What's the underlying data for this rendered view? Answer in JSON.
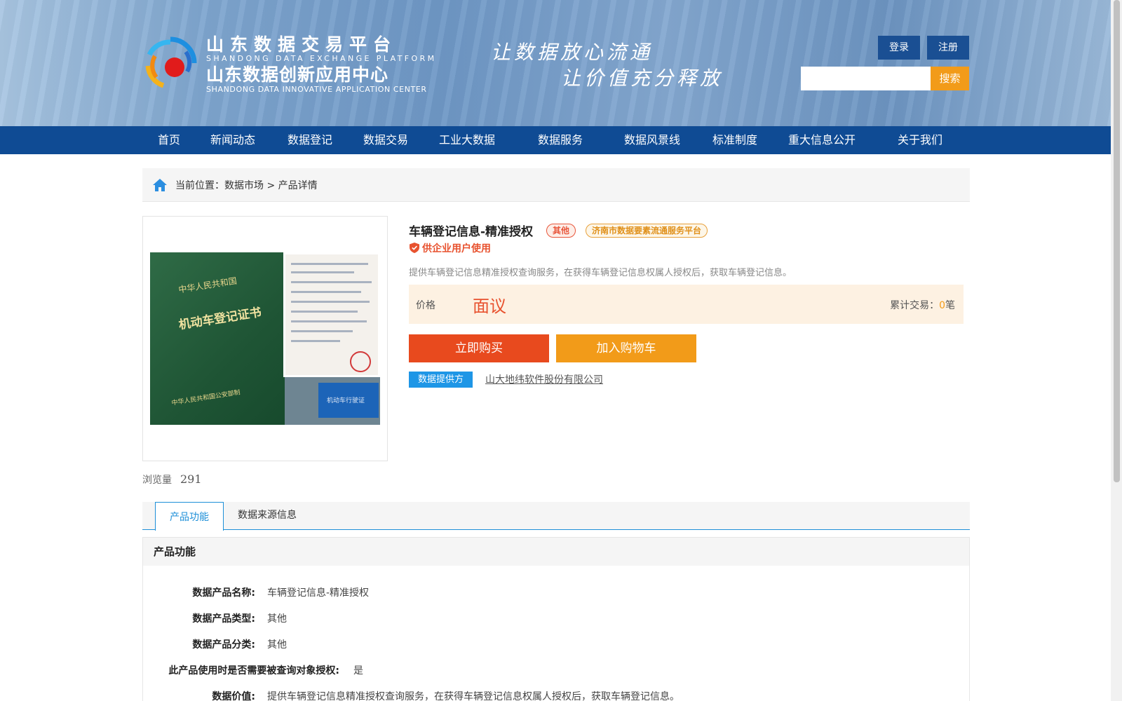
{
  "header": {
    "brand_cn1": "山东数据交易平台",
    "brand_en1": "SHANDONG DATA EXCHANGE PLATFORM",
    "brand_cn2": "山东数据创新应用中心",
    "brand_en2": "SHANDONG DATA INNOVATIVE APPLICATION CENTER",
    "slogan1": "让数据放心流通",
    "slogan2": "让价值充分释放",
    "login": "登录",
    "register": "注册",
    "search_placeholder": "",
    "search_button": "搜索"
  },
  "nav": {
    "items": [
      "首页",
      "新闻动态",
      "数据登记",
      "数据交易",
      "工业大数据",
      "数据服务",
      "数据风景线",
      "标准制度",
      "重大信息公开",
      "关于我们"
    ]
  },
  "breadcrumb": {
    "text": "当前位置：数据市场 > 产品详情"
  },
  "product": {
    "title": "车辆登记信息-精准授权",
    "tag_other": "其他",
    "tag_platform": "济南市数据要素流通服务平台",
    "enterprise_only": "供企业用户使用",
    "description": "提供车辆登记信息精准授权查询服务，在获得车辆登记信息权属人授权后，获取车辆登记信息。",
    "price_label": "价格",
    "price_value": "面议",
    "total_label": "累计交易：",
    "total_count": "0",
    "total_unit": "笔",
    "buy_button": "立即购买",
    "cart_button": "加入购物车",
    "provider_label": "数据提供方",
    "provider_name": "山大地纬软件股份有限公司",
    "views_label": "浏览量",
    "views_count": "291",
    "image_text": {
      "country": "中华人民共和国",
      "certificate": "机动车登记证书",
      "issuer": "中华人民共和国公安部制",
      "card": "机动车行驶证"
    }
  },
  "tabs": {
    "function": "产品功能",
    "source": "数据来源信息"
  },
  "section": {
    "title": "产品功能",
    "rows": [
      {
        "key": "数据产品名称:",
        "value": "车辆登记信息-精准授权"
      },
      {
        "key": "数据产品类型:",
        "value": "其他"
      },
      {
        "key": "数据产品分类:",
        "value": "其他"
      },
      {
        "key": "此产品使用时是否需要被查询对象授权:",
        "value": "是"
      },
      {
        "key": "数据价值:",
        "value": "提供车辆登记信息精准授权查询服务，在获得车辆登记信息权属人授权后，获取车辆登记信息。"
      }
    ]
  },
  "colors": {
    "nav_bg": "#0f4b94",
    "accent_orange": "#f29b19",
    "buy_red": "#e84a1e",
    "link_blue": "#1d8fd8"
  }
}
